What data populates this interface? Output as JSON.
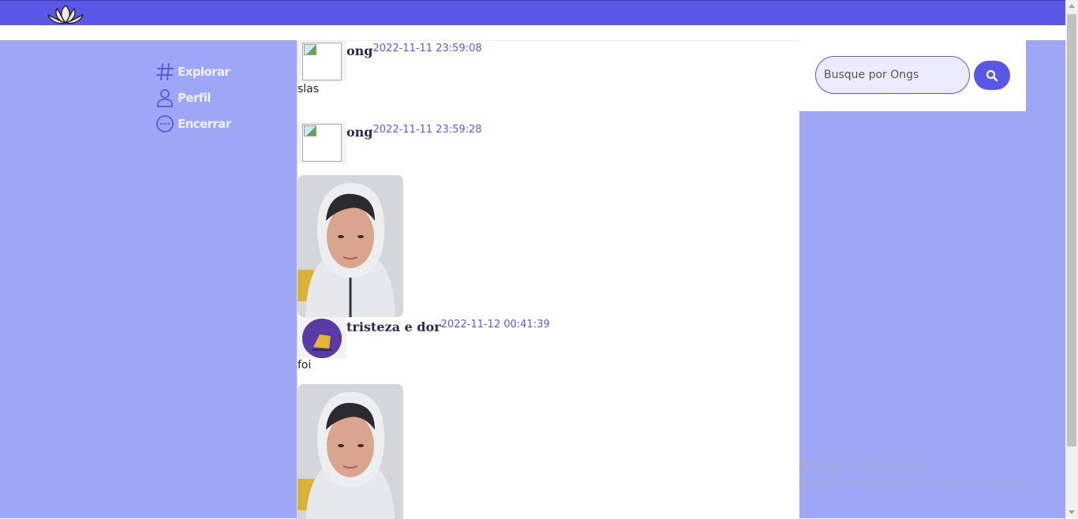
{
  "header": {
    "logo_icon": "lotus-icon",
    "accent_color": "#5b57e6"
  },
  "nav": {
    "items": [
      {
        "label": "Explorar",
        "icon": "hash-icon"
      },
      {
        "label": "Perfil",
        "icon": "user-icon"
      },
      {
        "label": "Encerrar",
        "icon": "more-circle-icon"
      }
    ]
  },
  "search": {
    "placeholder": "Busque por Ongs",
    "button_icon": "search-icon"
  },
  "posts": [
    {
      "author": "ong",
      "timestamp": "2022-11-11 23:59:08",
      "text": "slas"
    },
    {
      "author": "ong",
      "timestamp": "2022-11-11 23:59:28",
      "text": ""
    },
    {
      "author": "tristeza e dor",
      "timestamp": "2022-11-12 00:41:39",
      "text": "foi"
    }
  ],
  "watermark": {
    "title": "Ativar o Windows",
    "subtitle": "Acesse Configurações para ativar o Windows."
  }
}
